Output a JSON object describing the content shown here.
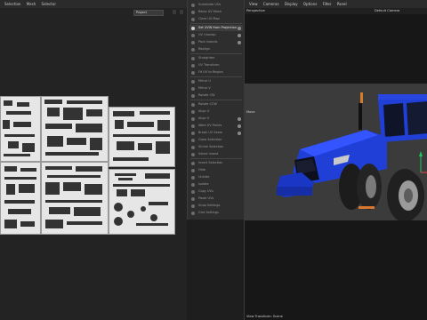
{
  "left_menu": {
    "items": [
      "Selection",
      "Mesh",
      "Selector"
    ]
  },
  "uv_view": {
    "projection_select": "Project"
  },
  "cmd_panel": {
    "items": [
      {
        "label": "Subdivide UVs",
        "highlight": false
      },
      {
        "label": "Relax UV Mesh",
        "highlight": false
      },
      {
        "label": "Clear UV Map",
        "highlight": false
      },
      {
        "label": "Set UVW from Projection",
        "highlight": true
      },
      {
        "label": "UV Unwrap",
        "highlight": false
      },
      {
        "label": "Pack Islands",
        "highlight": false
      },
      {
        "label": "Realign",
        "highlight": false
      },
      {
        "label": "Straighten",
        "highlight": false
      },
      {
        "label": "UV Transform",
        "highlight": false
      },
      {
        "label": "Fit UV to Region",
        "highlight": false
      },
      {
        "label": "Mirror U",
        "highlight": false
      },
      {
        "label": "Mirror V",
        "highlight": false
      },
      {
        "label": "Rotate CW",
        "highlight": false
      },
      {
        "label": "Rotate CCW",
        "highlight": false
      },
      {
        "label": "Align U",
        "highlight": false
      },
      {
        "label": "Align V",
        "highlight": false
      },
      {
        "label": "Weld UV Points",
        "highlight": false
      },
      {
        "label": "Break UV Seam",
        "highlight": false
      },
      {
        "label": "Grow Selection",
        "highlight": false
      },
      {
        "label": "Shrink Selection",
        "highlight": false
      },
      {
        "label": "Select Island",
        "highlight": false
      },
      {
        "label": "Invert Selection",
        "highlight": false
      },
      {
        "label": "Hide",
        "highlight": false
      },
      {
        "label": "Unhide",
        "highlight": false
      },
      {
        "label": "Isolate",
        "highlight": false
      },
      {
        "label": "Copy UVs",
        "highlight": false
      },
      {
        "label": "Paste UVs",
        "highlight": false
      },
      {
        "label": "Snap Settings",
        "highlight": false
      },
      {
        "label": "Grid Settings",
        "highlight": false
      },
      {
        "label": "Display",
        "highlight": false
      },
      {
        "label": "Preferences",
        "highlight": false
      },
      {
        "label": "History",
        "highlight": false
      }
    ]
  },
  "viewport": {
    "menu": [
      "View",
      "Cameras",
      "Display",
      "Options",
      "Filter",
      "Panel"
    ],
    "header_left": "Perspective",
    "camera": "Default Camera",
    "object_label": "Move",
    "footer": "View Transform: Scene"
  },
  "colors": {
    "tractor_blue": "#1f3fd6",
    "panel_bg": "#2e2e2e",
    "uv_fill": "#e6e6e6"
  }
}
